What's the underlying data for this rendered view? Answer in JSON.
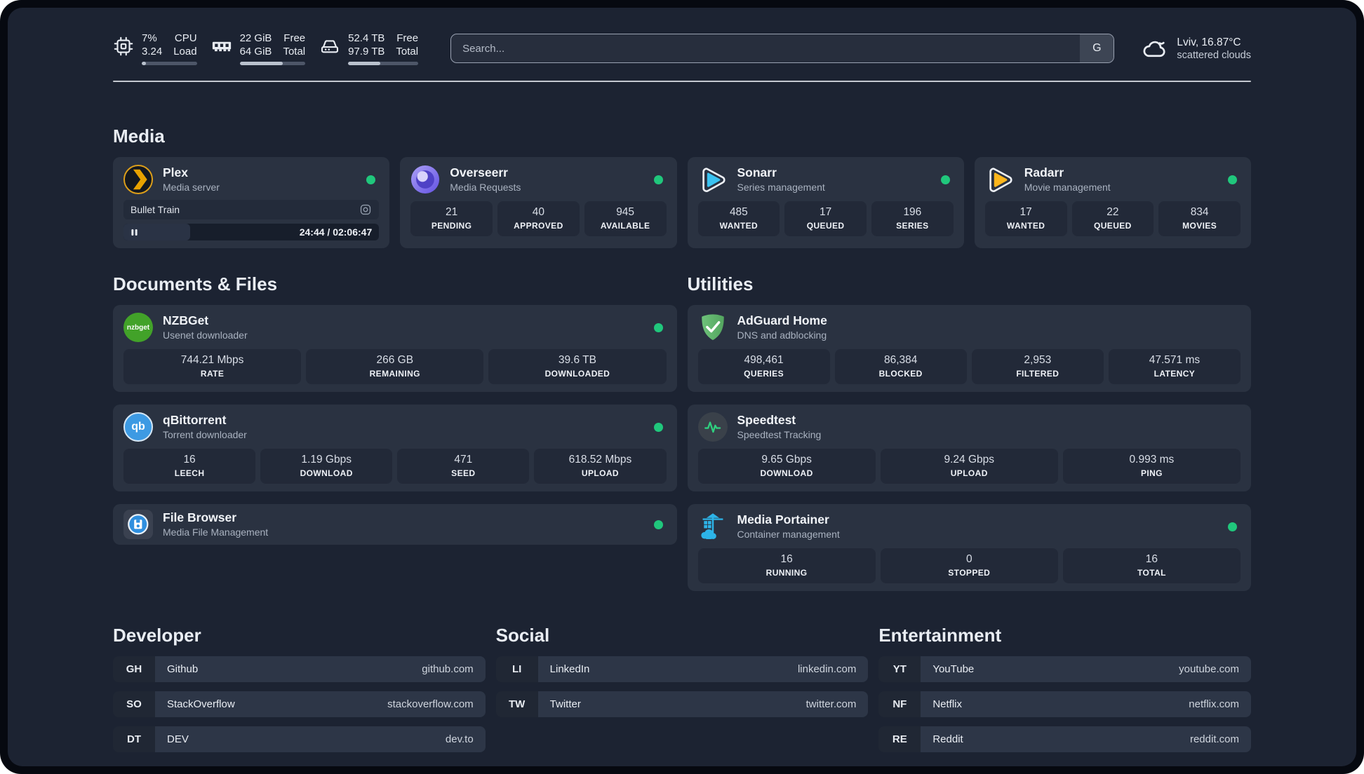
{
  "header": {
    "stats": [
      {
        "icon": "cpu-icon",
        "name": "cpu",
        "value_top": "7%",
        "value_bottom": "3.24",
        "label_top": "CPU",
        "label_bottom": "Load",
        "progress_pct": 7
      },
      {
        "icon": "ram-icon",
        "name": "memory",
        "value_top": "22 GiB",
        "value_bottom": "64 GiB",
        "label_top": "Free",
        "label_bottom": "Total",
        "progress_pct": 66
      },
      {
        "icon": "disk-icon",
        "name": "storage",
        "value_top": "52.4 TB",
        "value_bottom": "97.9 TB",
        "label_top": "Free",
        "label_bottom": "Total",
        "progress_pct": 46
      }
    ],
    "search": {
      "placeholder": "Search...",
      "provider_button": "G"
    },
    "weather": {
      "icon": "cloud-icon",
      "location_temp": "Lviv, 16.87°C",
      "condition": "scattered clouds"
    }
  },
  "sections": {
    "media": {
      "title": "Media",
      "cards": [
        {
          "icon": "plex-icon",
          "title": "Plex",
          "subtitle": "Media server",
          "status": "online",
          "media_player": {
            "now_playing": "Bullet Train",
            "state": "paused",
            "time_display": "24:44 / 02:06:47",
            "progress_pct": 26
          }
        },
        {
          "icon": "overseerr-icon",
          "title": "Overseerr",
          "subtitle": "Media Requests",
          "status": "online",
          "stats": [
            {
              "value": "21",
              "label": "PENDING"
            },
            {
              "value": "40",
              "label": "APPROVED"
            },
            {
              "value": "945",
              "label": "AVAILABLE"
            }
          ]
        },
        {
          "icon": "sonarr-icon",
          "title": "Sonarr",
          "subtitle": "Series management",
          "status": "online",
          "stats": [
            {
              "value": "485",
              "label": "WANTED"
            },
            {
              "value": "17",
              "label": "QUEUED"
            },
            {
              "value": "196",
              "label": "SERIES"
            }
          ]
        },
        {
          "icon": "radarr-icon",
          "title": "Radarr",
          "subtitle": "Movie management",
          "status": "online",
          "stats": [
            {
              "value": "17",
              "label": "WANTED"
            },
            {
              "value": "22",
              "label": "QUEUED"
            },
            {
              "value": "834",
              "label": "MOVIES"
            }
          ]
        }
      ]
    },
    "documents": {
      "title": "Documents & Files",
      "cards": [
        {
          "icon": "nzbget-icon",
          "title": "NZBGet",
          "subtitle": "Usenet downloader",
          "status": "online",
          "stats": [
            {
              "value": "744.21 Mbps",
              "label": "RATE"
            },
            {
              "value": "266 GB",
              "label": "REMAINING"
            },
            {
              "value": "39.6 TB",
              "label": "DOWNLOADED"
            }
          ]
        },
        {
          "icon": "qbittorrent-icon",
          "title": "qBittorrent",
          "subtitle": "Torrent downloader",
          "status": "online",
          "stats": [
            {
              "value": "16",
              "label": "LEECH"
            },
            {
              "value": "1.19 Gbps",
              "label": "DOWNLOAD"
            },
            {
              "value": "471",
              "label": "SEED"
            },
            {
              "value": "618.52 Mbps",
              "label": "UPLOAD"
            }
          ]
        },
        {
          "icon": "filebrowser-icon",
          "title": "File Browser",
          "subtitle": "Media File Management",
          "status": "online"
        }
      ]
    },
    "utilities": {
      "title": "Utilities",
      "cards": [
        {
          "icon": "adguard-icon",
          "title": "AdGuard Home",
          "subtitle": "DNS and adblocking",
          "stats": [
            {
              "value": "498,461",
              "label": "QUERIES"
            },
            {
              "value": "86,384",
              "label": "BLOCKED"
            },
            {
              "value": "2,953",
              "label": "FILTERED"
            },
            {
              "value": "47.571 ms",
              "label": "LATENCY"
            }
          ]
        },
        {
          "icon": "speedtest-icon",
          "title": "Speedtest",
          "subtitle": "Speedtest Tracking",
          "stats": [
            {
              "value": "9.65 Gbps",
              "label": "DOWNLOAD"
            },
            {
              "value": "9.24 Gbps",
              "label": "UPLOAD"
            },
            {
              "value": "0.993 ms",
              "label": "PING"
            }
          ]
        },
        {
          "icon": "portainer-icon",
          "title": "Media Portainer",
          "subtitle": "Container management",
          "status": "online",
          "stats": [
            {
              "value": "16",
              "label": "RUNNING"
            },
            {
              "value": "0",
              "label": "STOPPED"
            },
            {
              "value": "16",
              "label": "TOTAL"
            }
          ]
        }
      ]
    }
  },
  "link_sections": [
    {
      "title": "Developer",
      "links": [
        {
          "abbr": "GH",
          "name": "Github",
          "url": "github.com"
        },
        {
          "abbr": "SO",
          "name": "StackOverflow",
          "url": "stackoverflow.com"
        },
        {
          "abbr": "DT",
          "name": "DEV",
          "url": "dev.to"
        }
      ]
    },
    {
      "title": "Social",
      "links": [
        {
          "abbr": "LI",
          "name": "LinkedIn",
          "url": "linkedin.com"
        },
        {
          "abbr": "TW",
          "name": "Twitter",
          "url": "twitter.com"
        }
      ]
    },
    {
      "title": "Entertainment",
      "links": [
        {
          "abbr": "YT",
          "name": "YouTube",
          "url": "youtube.com"
        },
        {
          "abbr": "NF",
          "name": "Netflix",
          "url": "netflix.com"
        },
        {
          "abbr": "RE",
          "name": "Reddit",
          "url": "reddit.com"
        }
      ]
    }
  ],
  "colors": {
    "status_online": "#20c77c",
    "accent": "#2db4e8",
    "page_background": "#1c2332"
  }
}
